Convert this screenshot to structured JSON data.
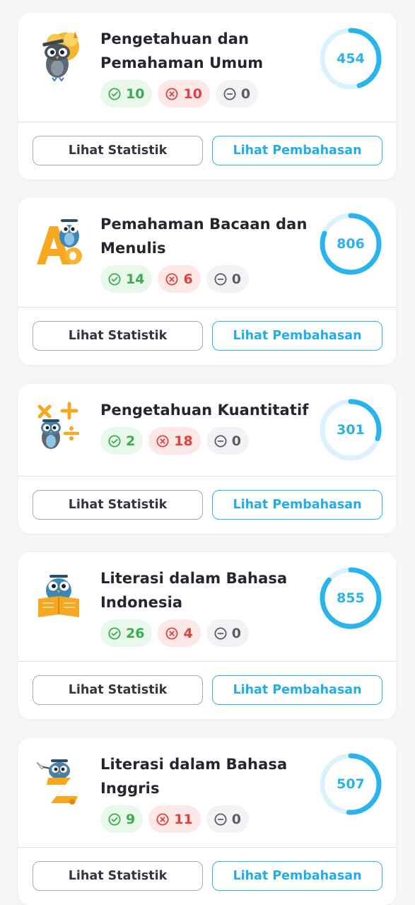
{
  "colors": {
    "accent": "#2ab4ec",
    "ring_track": "#dbf2fd",
    "correct": "#3dab4e",
    "wrong": "#e0423e",
    "empty": "#5c5c66"
  },
  "cards": [
    {
      "title": "Pengetahuan dan Pemahaman Umum",
      "mascot_icon": "owl-lightbulb-icon",
      "correct": "10",
      "wrong": "10",
      "empty": "0",
      "score": "454",
      "score_fraction": 0.45,
      "stats_label": "Lihat Statistik",
      "discussion_label": "Lihat Pembahasan"
    },
    {
      "title": "Pemahaman Bacaan dan Menulis",
      "mascot_icon": "owl-letters-icon",
      "correct": "14",
      "wrong": "6",
      "empty": "0",
      "score": "806",
      "score_fraction": 0.81,
      "stats_label": "Lihat Statistik",
      "discussion_label": "Lihat Pembahasan"
    },
    {
      "title": "Pengetahuan Kuantitatif",
      "mascot_icon": "owl-math-icon",
      "correct": "2",
      "wrong": "18",
      "empty": "0",
      "score": "301",
      "score_fraction": 0.3,
      "stats_label": "Lihat Statistik",
      "discussion_label": "Lihat Pembahasan"
    },
    {
      "title": "Literasi dalam Bahasa Indonesia",
      "mascot_icon": "owl-reading-icon",
      "correct": "26",
      "wrong": "4",
      "empty": "0",
      "score": "855",
      "score_fraction": 0.86,
      "stats_label": "Lihat Statistik",
      "discussion_label": "Lihat Pembahasan"
    },
    {
      "title": "Literasi dalam Bahasa Inggris",
      "mascot_icon": "owl-scroll-icon",
      "correct": "9",
      "wrong": "11",
      "empty": "0",
      "score": "507",
      "score_fraction": 0.51,
      "stats_label": "Lihat Statistik",
      "discussion_label": "Lihat Pembahasan"
    }
  ]
}
